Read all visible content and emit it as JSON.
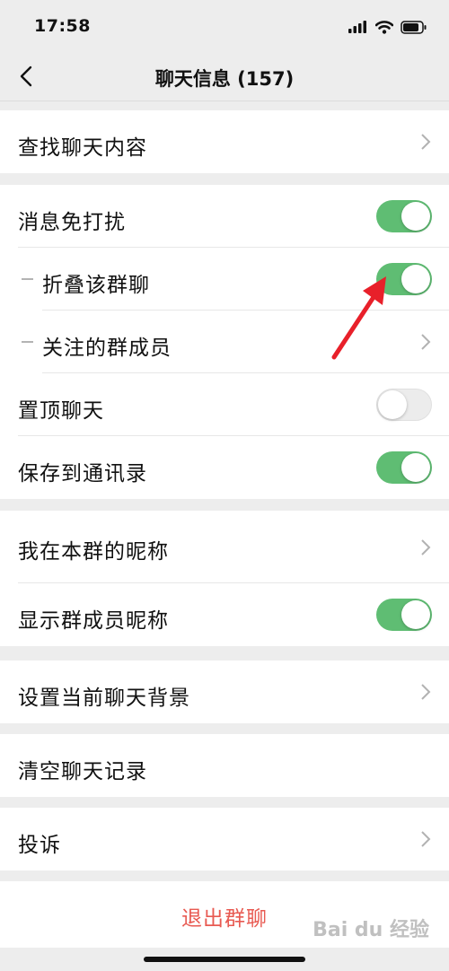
{
  "status": {
    "time": "17:58"
  },
  "nav": {
    "title": "聊天信息 (157)"
  },
  "groups": {
    "search": {
      "label": "查找聊天内容"
    },
    "mute": {
      "dnd": {
        "label": "消息免打扰",
        "on": true
      },
      "fold": {
        "label": "折叠该群聊",
        "on": true
      },
      "followed": {
        "label": "关注的群成员"
      },
      "pin": {
        "label": "置顶聊天",
        "on": false
      },
      "save": {
        "label": "保存到通讯录",
        "on": true
      }
    },
    "nick": {
      "my_nick": {
        "label": "我在本群的昵称"
      },
      "show_nick": {
        "label": "显示群成员昵称",
        "on": true
      }
    },
    "bg": {
      "label": "设置当前聊天背景"
    },
    "clear": {
      "label": "清空聊天记录"
    },
    "complain": {
      "label": "投诉"
    },
    "exit": {
      "label": "退出群聊"
    }
  },
  "colors": {
    "toggle_on": "#5fbd73",
    "danger": "#e85a52",
    "annotation_arrow": "#e8202a"
  },
  "watermark": "Bai du 经验"
}
